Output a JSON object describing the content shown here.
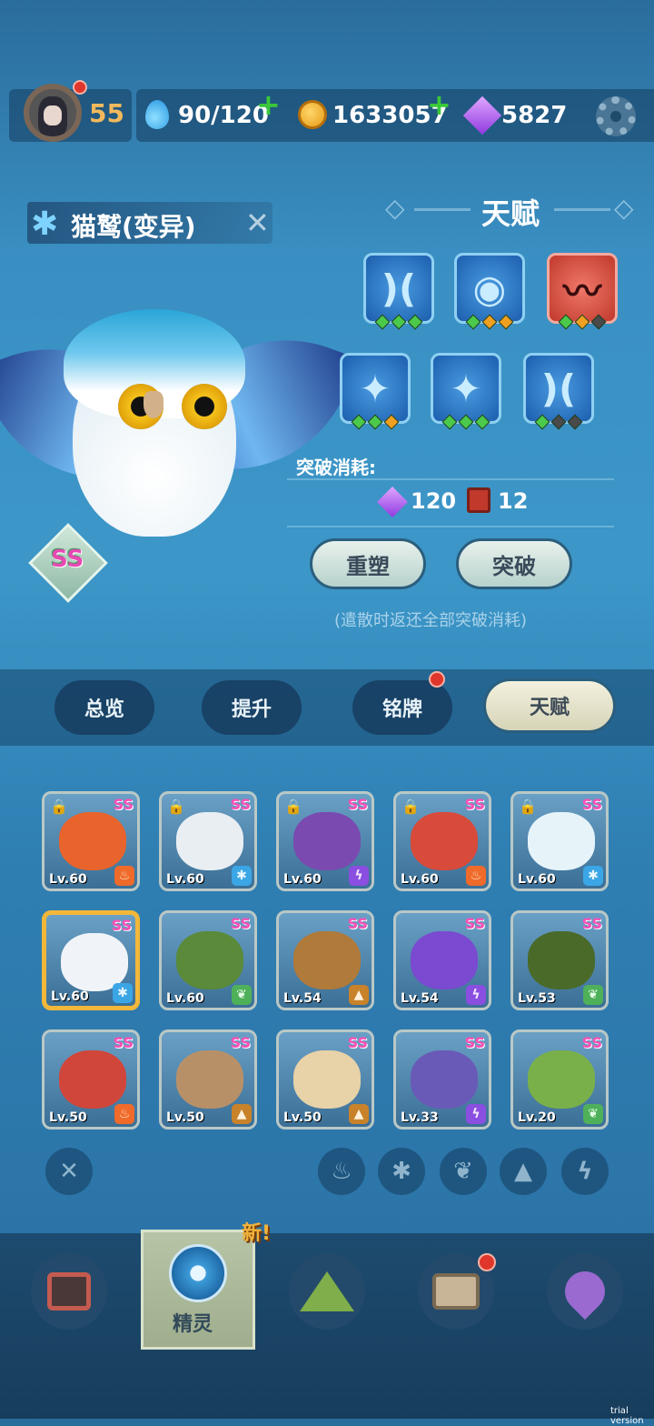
{
  "player": {
    "level": "55"
  },
  "resources": {
    "stamina": "90/120",
    "coins": "1633057",
    "gems": "5827"
  },
  "pet": {
    "name": "猫鹫(变异)",
    "rank": "SS"
  },
  "talent": {
    "title": "天赋",
    "cost_label": "突破消耗:",
    "cost_gems": "120",
    "cost_books": "12",
    "reset_label": "重塑",
    "break_label": "突破",
    "hint": "(遣散时返还全部突破消耗)",
    "slots": [
      {
        "icon": "moon-icon",
        "stars": [
          "g",
          "g",
          "g"
        ]
      },
      {
        "icon": "eye-icon",
        "stars": [
          "g",
          "o",
          "o"
        ]
      },
      {
        "icon": "fang-icon",
        "stars": [
          "g",
          "o",
          "k"
        ]
      },
      {
        "icon": "claw-icon",
        "stars": [
          "g",
          "g",
          "o"
        ]
      },
      {
        "icon": "claw-icon",
        "stars": [
          "g",
          "g",
          "g"
        ]
      },
      {
        "icon": "moon-icon",
        "stars": [
          "g",
          "k",
          "k"
        ]
      }
    ]
  },
  "tabs": [
    "总览",
    "提升",
    "铭牌",
    "天赋"
  ],
  "pets": [
    {
      "level": "Lv.60",
      "rank": "SS",
      "element": "fire",
      "color": "#e8642c",
      "locked": true
    },
    {
      "level": "Lv.60",
      "rank": "SS",
      "element": "ice",
      "color": "#e8eef2",
      "locked": true
    },
    {
      "level": "Lv.60",
      "rank": "SS",
      "element": "bolt",
      "color": "#7a4ab0",
      "locked": true
    },
    {
      "level": "Lv.60",
      "rank": "SS",
      "element": "fire",
      "color": "#d84a3a",
      "locked": true
    },
    {
      "level": "Lv.60",
      "rank": "SS",
      "element": "ice",
      "color": "#e6f4fa",
      "locked": true
    },
    {
      "level": "Lv.60",
      "rank": "SS",
      "element": "ice",
      "color": "#f0f4f8",
      "locked": false
    },
    {
      "level": "Lv.60",
      "rank": "SS",
      "element": "leaf",
      "color": "#5a8a3a",
      "locked": false
    },
    {
      "level": "Lv.54",
      "rank": "SS",
      "element": "rock",
      "color": "#b07a3a",
      "locked": false
    },
    {
      "level": "Lv.54",
      "rank": "SS",
      "element": "bolt",
      "color": "#7a4ad0",
      "locked": false
    },
    {
      "level": "Lv.53",
      "rank": "SS",
      "element": "leaf",
      "color": "#4a6a2a",
      "locked": false
    },
    {
      "level": "Lv.50",
      "rank": "SS",
      "element": "fire",
      "color": "#d0463a",
      "locked": false
    },
    {
      "level": "Lv.50",
      "rank": "SS",
      "element": "rock",
      "color": "#b89068",
      "locked": false
    },
    {
      "level": "Lv.50",
      "rank": "SS",
      "element": "rock",
      "color": "#e8d2a8",
      "locked": false
    },
    {
      "level": "Lv.33",
      "rank": "SS",
      "element": "bolt",
      "color": "#6a5ab8",
      "locked": false
    },
    {
      "level": "Lv.20",
      "rank": "SS",
      "element": "leaf",
      "color": "#7ab04a",
      "locked": false
    }
  ],
  "nav": {
    "new_badge": "新!",
    "active_label": "精灵"
  },
  "watermark": "trial version"
}
